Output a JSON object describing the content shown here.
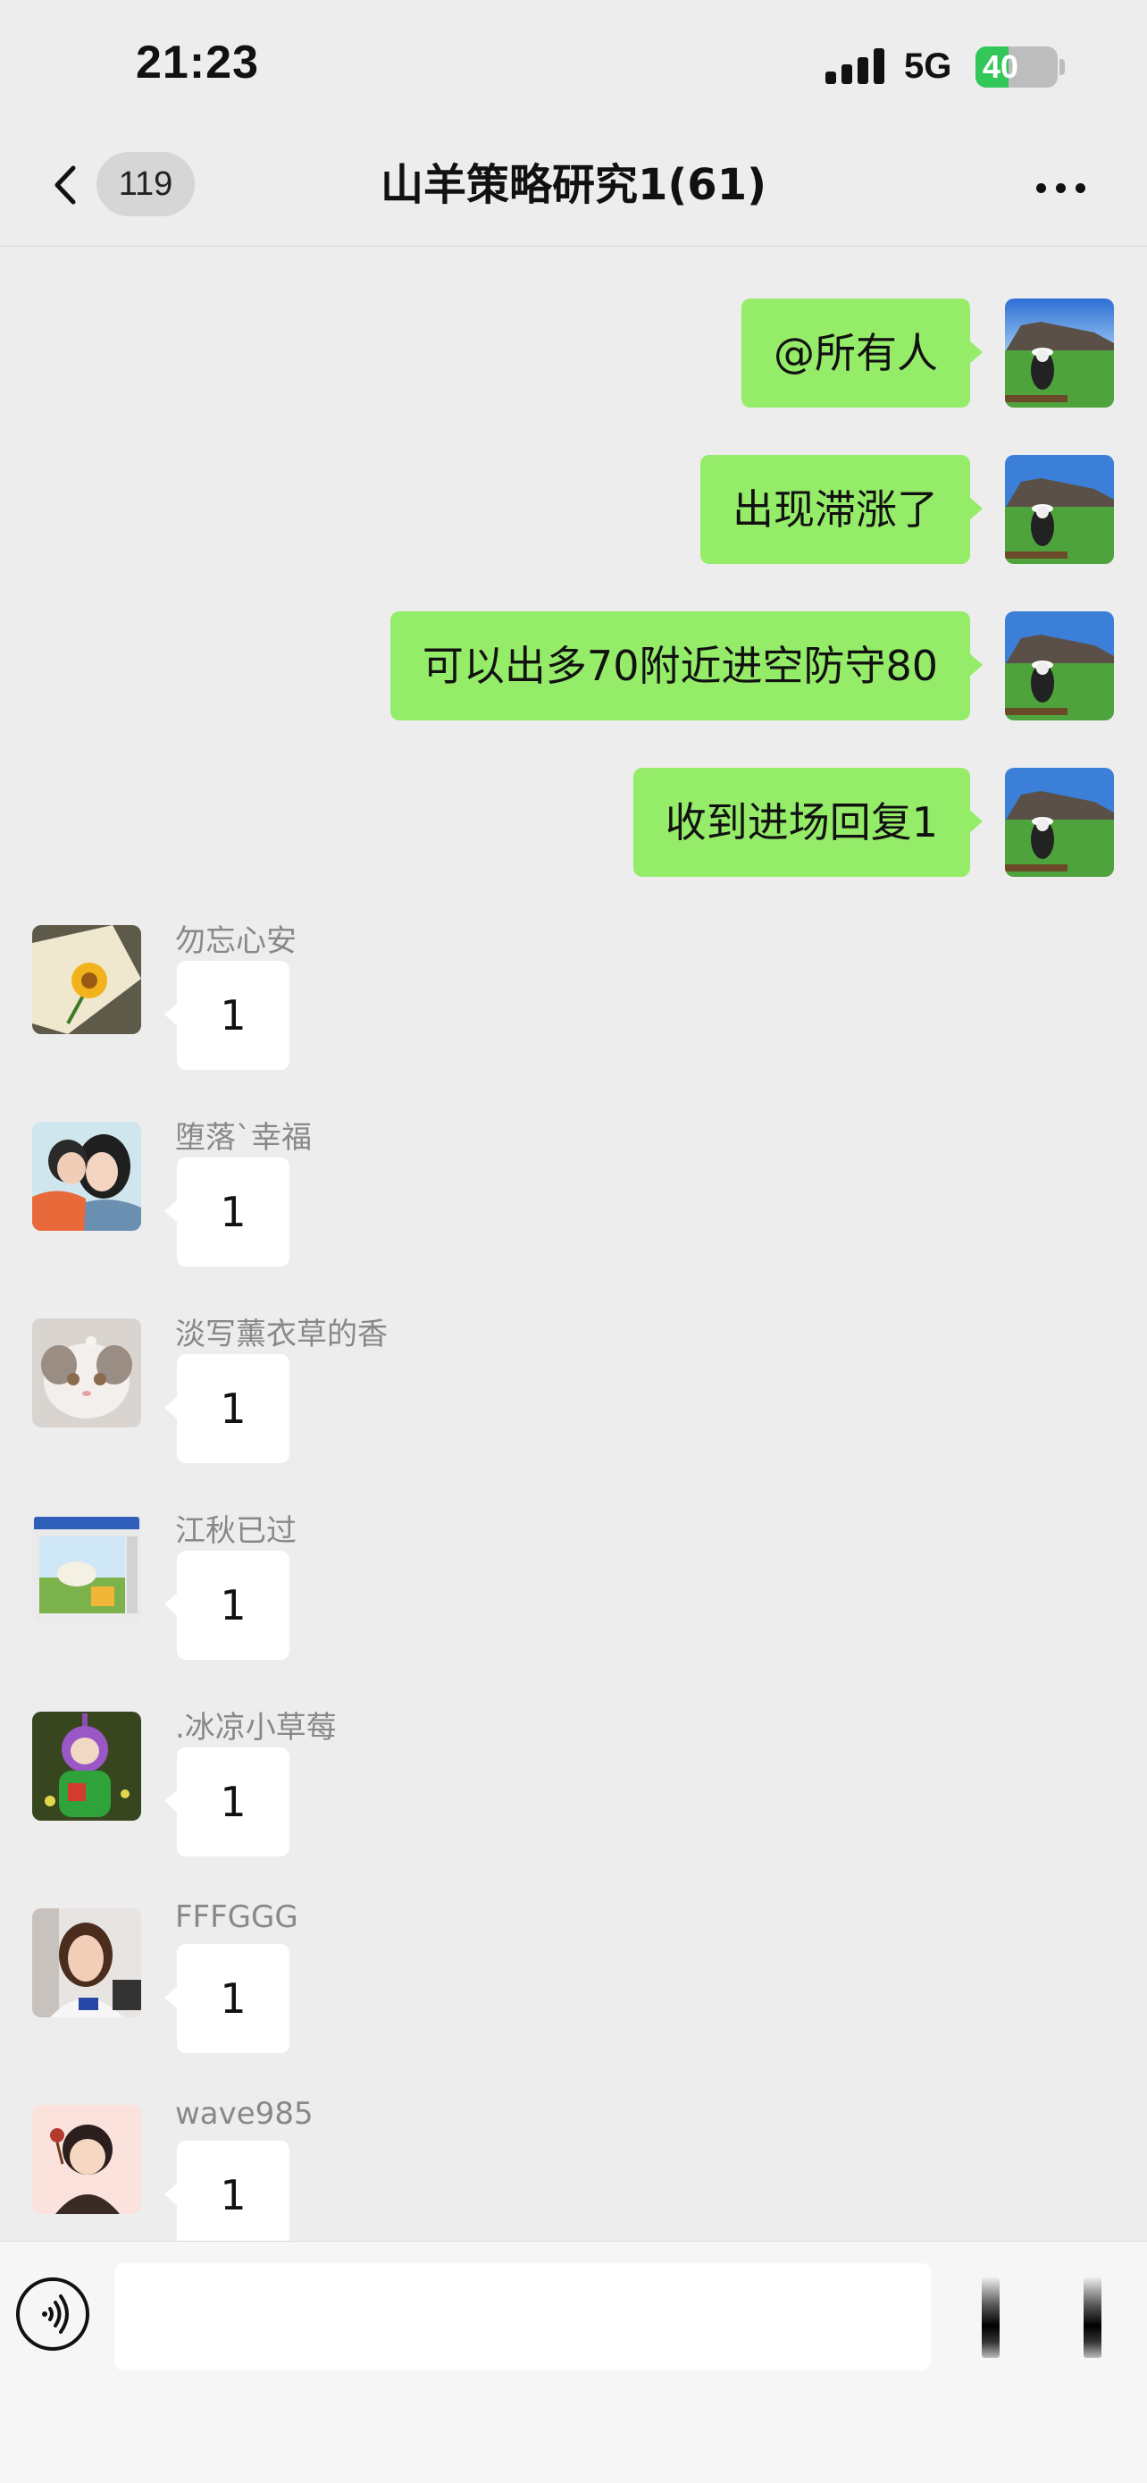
{
  "status_bar": {
    "time": "21:23",
    "network": "5G",
    "battery": "40",
    "battery_level": 0.4
  },
  "header": {
    "back_count": "119",
    "title": "山羊策略研究1(61)"
  },
  "outgoing_messages": [
    {
      "text": "@所有人"
    },
    {
      "text": "出现滞涨了"
    },
    {
      "text": "可以出多70附近进空防守80"
    },
    {
      "text": "收到进场回复1"
    }
  ],
  "incoming_messages": [
    {
      "sender": "勿忘心安",
      "text": "1",
      "avatar": "sunflower-avatar"
    },
    {
      "sender": "堕落`幸福",
      "text": "1",
      "avatar": "couple-cartoon-avatar"
    },
    {
      "sender": "淡写薰衣草的香",
      "text": "1",
      "avatar": "cat-avatar"
    },
    {
      "sender": "江秋已过",
      "text": "1",
      "avatar": "window-screenshot-avatar"
    },
    {
      "sender": ".冰凉小草莓",
      "text": "1",
      "avatar": "teletubby-avatar"
    },
    {
      "sender": "FFFGGG",
      "text": "1",
      "avatar": "woman-photo-avatar"
    },
    {
      "sender": "wave985",
      "text": "1",
      "avatar": "girl-cartoon-avatar"
    }
  ],
  "input_bar": {
    "placeholder": ""
  },
  "colors": {
    "background": "#ededed",
    "outgoing_bubble": "#95ec69",
    "incoming_bubble": "#ffffff",
    "battery_green": "#33c659"
  }
}
